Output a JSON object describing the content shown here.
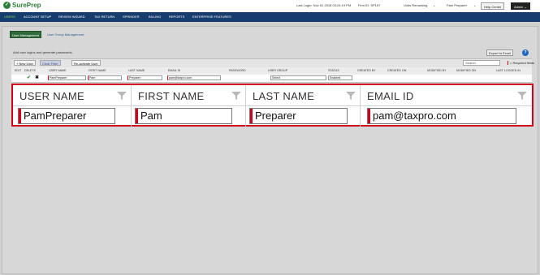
{
  "app": {
    "logo_text": "SurePrep",
    "last_login": "Last Login: Nov 02,2018 03:24:19 PM",
    "firm_id": "Firm ID: SP157",
    "units": "Units Remaining",
    "user_menu": "Pam Preparer",
    "help_center": "Help Center",
    "admin": "Admin"
  },
  "nav": [
    "USERS",
    "ACCOUNT SETUP",
    "REVIEW WIZARD",
    "TAX RETURN",
    "SPRINDER",
    "BILLING",
    "REPORTS",
    "ENTERPRISE FEATURES"
  ],
  "subtabs": {
    "active": "User Management",
    "other": "User Group Management"
  },
  "hint": "Add user logins and generate passwords.",
  "export": "Export to Excel",
  "toolbar": {
    "new_user": "+ New User",
    "clear_filter": "Clear Filter",
    "reactivate": "Re-activate User",
    "search_placeholder": "Search",
    "required": "= Required fields"
  },
  "small_columns": [
    "EDIT",
    "DELETE",
    "USER NAME",
    "FIRST NAME",
    "LAST NAME",
    "EMAIL ID",
    "PASSWORD",
    "USER GROUP",
    "STATUS",
    "CREATED BY",
    "CREATED ON",
    "MODIFIED BY",
    "MODIFIED ON",
    "LAST LOGGED IN"
  ],
  "small_row": {
    "user_name": "PamPreparer",
    "first_name": "Pam",
    "last_name": "Preparer",
    "email": "pam@taxpro.com",
    "user_group": "Select",
    "status": "Enabled"
  },
  "zoom": {
    "headers": [
      "USER NAME",
      "FIRST NAME",
      "LAST NAME",
      "EMAIL ID"
    ],
    "values": [
      "PamPreparer",
      "Pam",
      "Preparer",
      "pam@taxpro.com"
    ]
  }
}
